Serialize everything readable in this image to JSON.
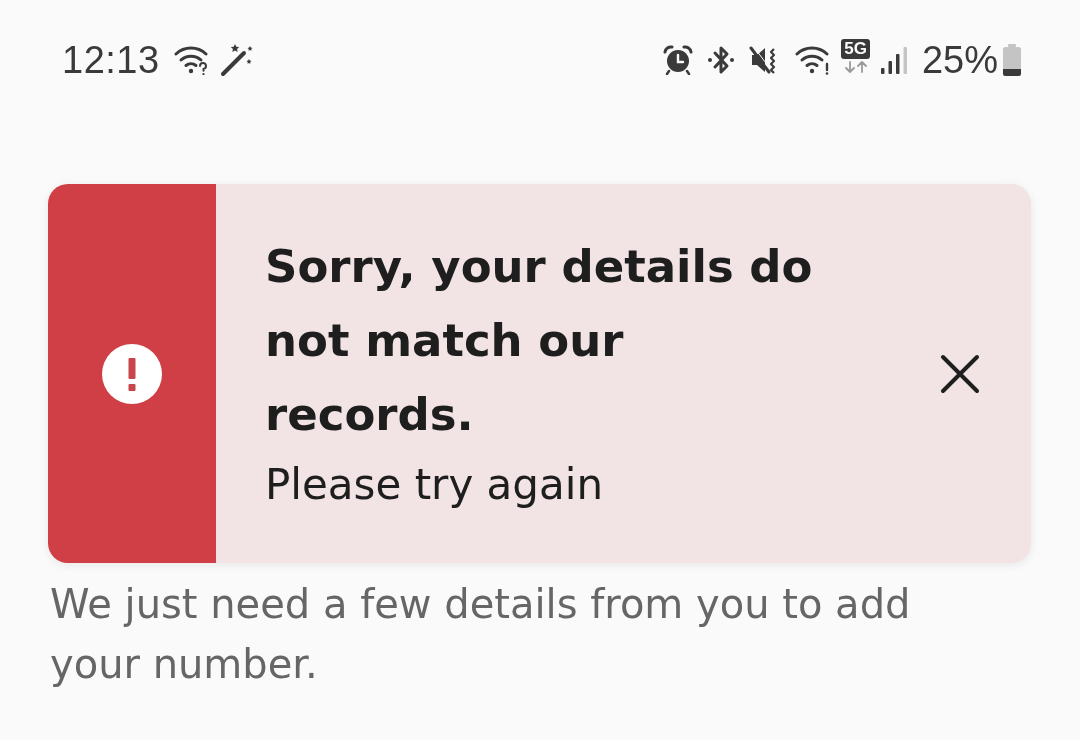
{
  "status_bar": {
    "time": "12:13",
    "network_type": "5G",
    "battery_percent": "25%"
  },
  "alert": {
    "kind": "error",
    "title": "Sorry, your details do not match our records.",
    "message": "Please try again"
  },
  "intro_text": "We just need a few details from you to add your number."
}
